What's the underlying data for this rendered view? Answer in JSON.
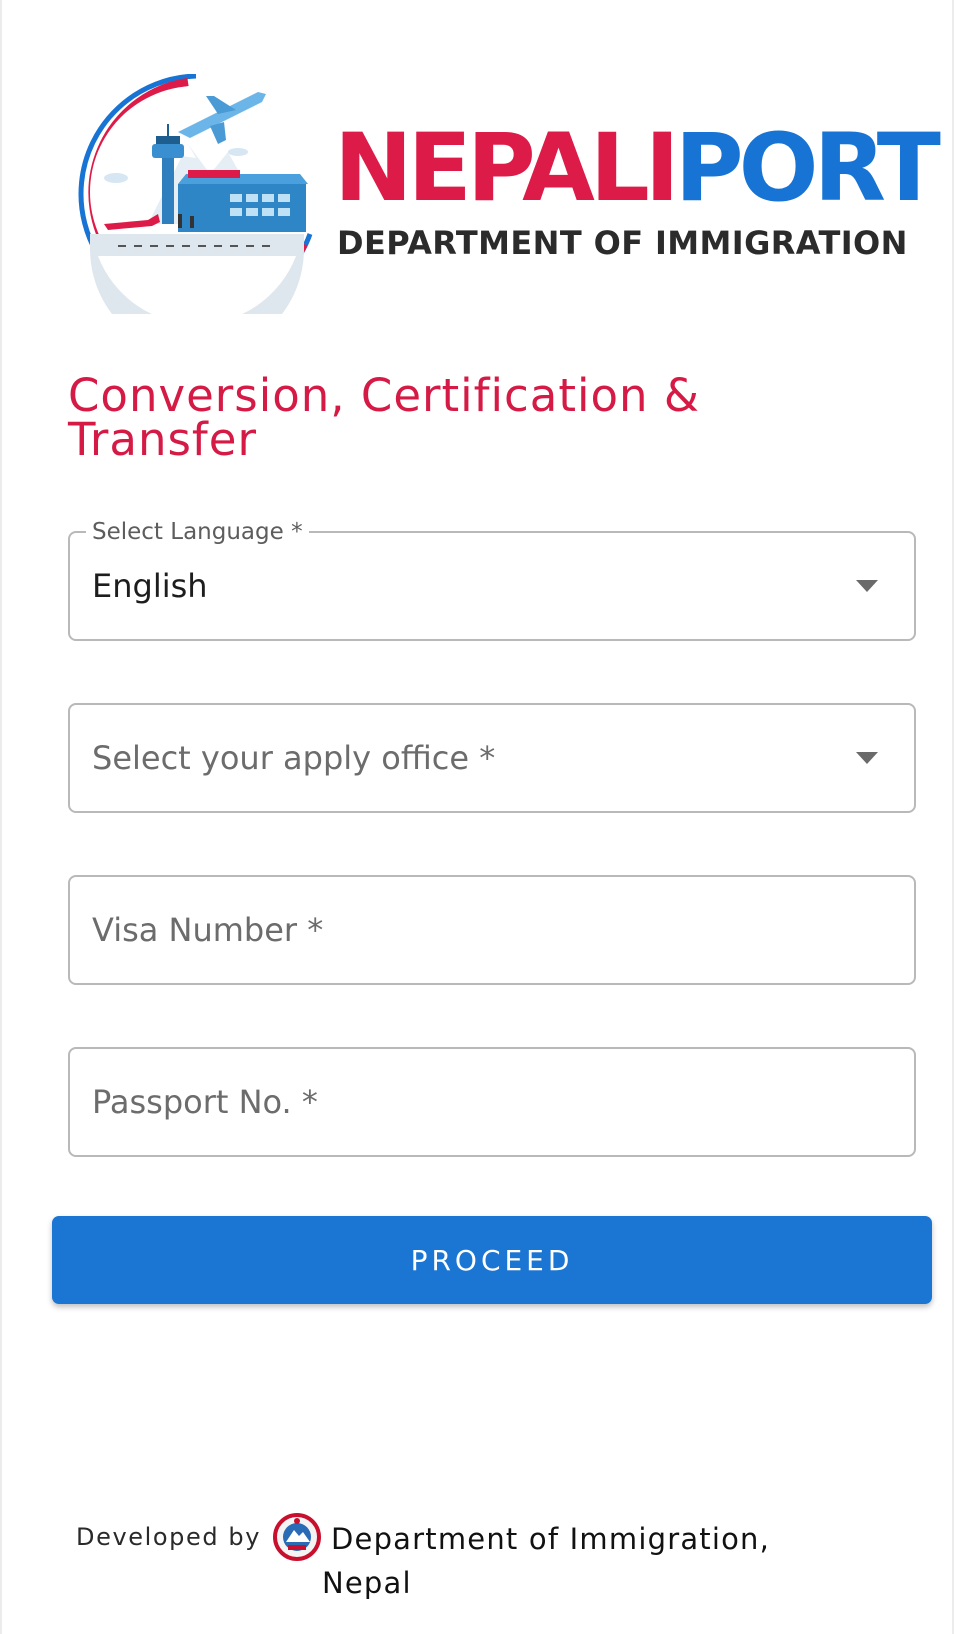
{
  "logo": {
    "wordmark_red": "NEPALI",
    "wordmark_blue": "PORT",
    "subtitle": "DEPARTMENT OF IMMIGRATION"
  },
  "page_title": "Conversion, Certification & Transfer",
  "form": {
    "language": {
      "label": "Select Language *",
      "value": "English"
    },
    "office": {
      "placeholder": "Select your apply office *"
    },
    "visa_number": {
      "placeholder": "Visa Number *"
    },
    "passport_no": {
      "placeholder": "Passport No. *"
    },
    "proceed_label": "PROCEED"
  },
  "footer": {
    "developed_by": "Developed by",
    "organization": "Department of Immigration, Nepal"
  },
  "colors": {
    "brand_red": "#dd1b48",
    "brand_blue": "#1774d4",
    "title_red": "#d41a45",
    "button_blue": "#1a76d2"
  },
  "icons": {
    "logo": "airport-plane-emblem-icon",
    "dropdown": "caret-down-icon",
    "footer_emblem": "nepal-emblem-icon"
  }
}
